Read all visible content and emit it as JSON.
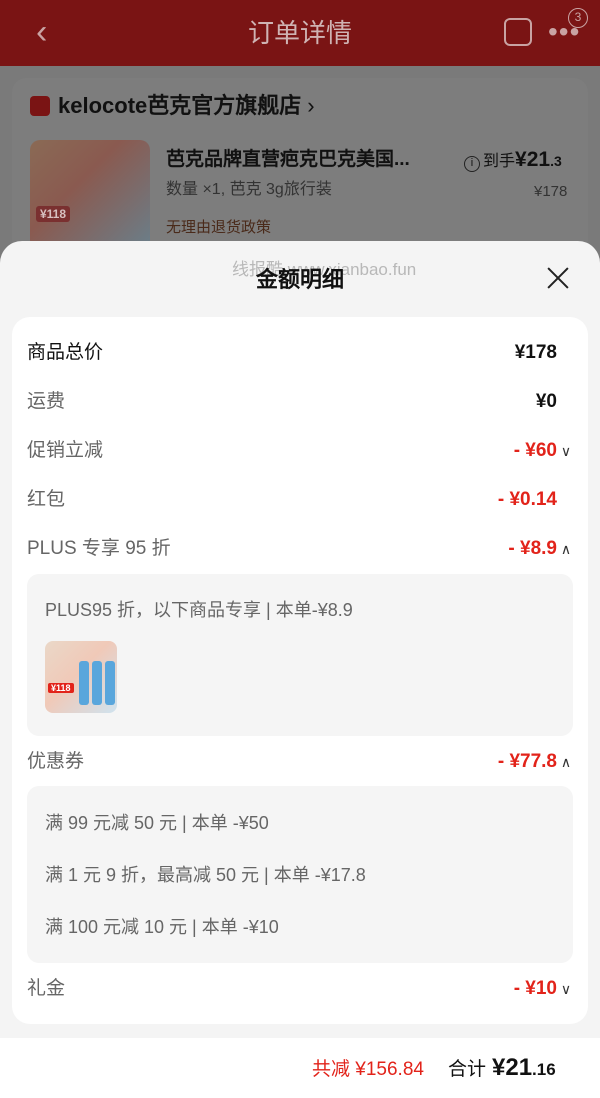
{
  "background_page": {
    "header": {
      "title": "订单详情",
      "badge_count": "3"
    },
    "store": {
      "name": "kelocote芭克官方旗舰店",
      "chevron": "›"
    },
    "product": {
      "title": "芭克品牌直营疤克巴克美国...",
      "spec": "数量 ×1, 芭克 3g旅行装",
      "policy": "无理由退货政策",
      "arrive_label": "到手",
      "arrive_price_big": "¥21",
      "arrive_price_small": ".3",
      "original_price": "¥178",
      "thumb_tag": "¥118"
    }
  },
  "sheet": {
    "title": "金额明细",
    "watermark": "线报酷 www.xianbao.fun",
    "rows": {
      "total_goods": {
        "label": "商品总价",
        "value": "¥178"
      },
      "shipping": {
        "label": "运费",
        "value": "¥0"
      },
      "promo": {
        "label": "促销立减",
        "value": "- ¥60",
        "arrow": "∨"
      },
      "redpacket": {
        "label": "红包",
        "value": "- ¥0.14"
      },
      "plus": {
        "label": "PLUS 专享 95 折",
        "value": "- ¥8.9",
        "arrow": "∧"
      },
      "coupon": {
        "label": "优惠券",
        "value": "- ¥77.8",
        "arrow": "∧"
      },
      "gift": {
        "label": "礼金",
        "value": "- ¥10",
        "arrow": "∨"
      }
    },
    "plus_detail": {
      "text": "PLUS95 折，以下商品专享 | 本单-¥8.9",
      "thumb_tag": "¥118"
    },
    "coupon_details": [
      "满 99 元减 50 元 | 本单 -¥50",
      "满 1 元 9 折，最高减 50 元 | 本单 -¥17.8",
      "满 100 元减 10 元 | 本单 -¥10"
    ]
  },
  "footer": {
    "saved": "共减 ¥156.84",
    "total_label": "合计",
    "total_big": "¥21",
    "total_small": ".16"
  },
  "colors": {
    "accent_red": "#e2231a",
    "header_bg": "#7a1414"
  }
}
